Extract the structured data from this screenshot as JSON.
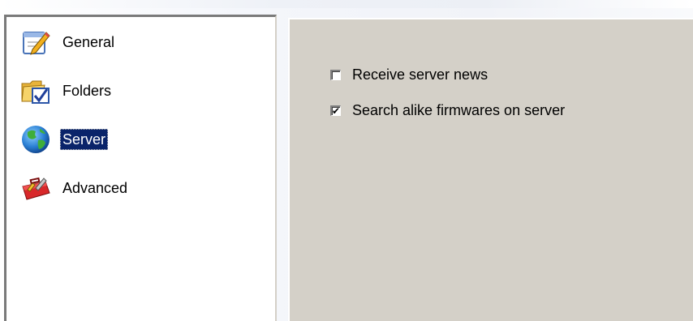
{
  "sidebar": {
    "items": [
      {
        "label": "General",
        "icon": "edit-icon",
        "selected": false
      },
      {
        "label": "Folders",
        "icon": "folder-check-icon",
        "selected": false
      },
      {
        "label": "Server",
        "icon": "globe-icon",
        "selected": true
      },
      {
        "label": "Advanced",
        "icon": "toolbox-icon",
        "selected": false
      }
    ]
  },
  "server": {
    "options": [
      {
        "label": "Receive server news",
        "checked": false
      },
      {
        "label": "Search alike firmwares on server",
        "checked": true
      }
    ]
  },
  "colors": {
    "selection_bg": "#0a246a",
    "panel_bg": "#d4d0c8"
  }
}
